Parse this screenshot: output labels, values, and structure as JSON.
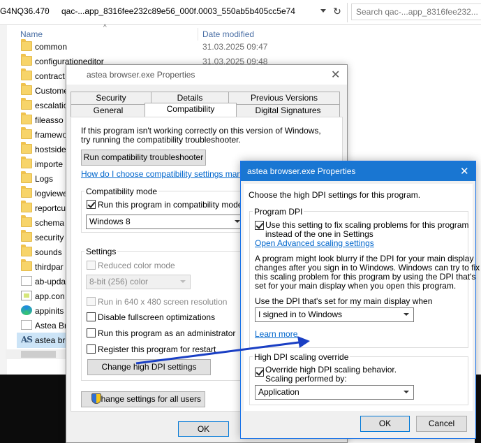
{
  "explorer": {
    "address_prefix": "G4NQ36.470",
    "address_sep": "›",
    "address_path": "qac-...app_8316fee232c89e56_000f.0003_550ab5b405cc5e74",
    "search_placeholder": "Search qac-...app_8316fee232...",
    "columns": {
      "name": "Name",
      "date": "Date modified"
    },
    "items": [
      {
        "name": "common",
        "date": "31.03.2025 09:47",
        "icon": "folder-icon"
      },
      {
        "name": "configurationeditor",
        "date": "31.03.2025 09:48",
        "icon": "folder-icon"
      },
      {
        "name": "contract",
        "date": "",
        "icon": "folder-icon"
      },
      {
        "name": "Custome",
        "date": "",
        "icon": "folder-icon"
      },
      {
        "name": "escalatio",
        "date": "",
        "icon": "folder-icon"
      },
      {
        "name": "fileasso",
        "date": "",
        "icon": "folder-icon"
      },
      {
        "name": "framewo",
        "date": "",
        "icon": "folder-icon"
      },
      {
        "name": "hostside",
        "date": "",
        "icon": "folder-icon"
      },
      {
        "name": "importe",
        "date": "",
        "icon": "folder-icon"
      },
      {
        "name": "Logs",
        "date": "",
        "icon": "folder-icon"
      },
      {
        "name": "logviewe",
        "date": "",
        "icon": "folder-icon"
      },
      {
        "name": "reportcu",
        "date": "",
        "icon": "folder-icon"
      },
      {
        "name": "schema",
        "date": "",
        "icon": "folder-icon"
      },
      {
        "name": "security",
        "date": "",
        "icon": "folder-icon"
      },
      {
        "name": "sounds",
        "date": "",
        "icon": "folder-icon"
      },
      {
        "name": "thirdpar",
        "date": "",
        "icon": "folder-icon"
      },
      {
        "name": "ab-upda",
        "date": "",
        "icon": "document-icon"
      },
      {
        "name": "app.con",
        "date": "",
        "icon": "config-file-icon"
      },
      {
        "name": "appinits",
        "date": "",
        "icon": "edge-icon"
      },
      {
        "name": "Astea Br",
        "date": "",
        "icon": "document-icon"
      },
      {
        "name": "astea bro",
        "date": "",
        "icon": "astea-app-icon"
      }
    ]
  },
  "props_dialog": {
    "title": "astea browser.exe Properties",
    "close": "✕",
    "tabs_row1": [
      "Security",
      "Details",
      "Previous Versions"
    ],
    "tabs_row2": [
      "General",
      "Compatibility",
      "Digital Signatures"
    ],
    "intro_line1": "If this program isn't working correctly on this version of Windows,",
    "intro_line2": "try running the compatibility troubleshooter.",
    "troubleshooter_button": "Run compatibility troubleshooter",
    "help_link": "How do I choose compatibility settings manually?",
    "compat_mode_label": "Compatibility mode",
    "compat_checkbox": "Run this program in compatibility mode for:",
    "compat_select": "Windows 8",
    "settings_label": "Settings",
    "reduced_color": "Reduced color mode",
    "color_select": "8-bit (256) color",
    "res_640": "Run in 640 x 480 screen resolution",
    "disable_fullscreen": "Disable fullscreen optimizations",
    "run_as_admin": "Run this program as an administrator",
    "register_restart": "Register this program for restart",
    "dpi_button": "Change high DPI settings",
    "all_users_button": "Change settings for all users",
    "ok": "OK"
  },
  "dpi_dialog": {
    "title": "astea browser.exe Properties",
    "close": "✕",
    "choose_text": "Choose the high DPI settings for this program.",
    "program_dpi_label": "Program DPI",
    "use_setting_line1": "Use this setting to fix scaling problems for this program",
    "use_setting_line2": "instead of the one in Settings",
    "advanced_link": "Open Advanced scaling settings",
    "blurry_lines": [
      "A program might look blurry if the DPI for your main display",
      "changes after you sign in to Windows. Windows can try to fix",
      "this scaling problem for this program by using the DPI that's",
      "set for your main display when you open this program."
    ],
    "use_dpi_label": "Use the DPI that's set for my main display when",
    "signin_select": "I signed in to Windows",
    "learn_more": "Learn more",
    "override_label": "High DPI scaling override",
    "override_line1": "Override high DPI scaling behavior.",
    "override_line2": "Scaling performed by:",
    "scaling_select": "Application",
    "ok": "OK",
    "cancel": "Cancel"
  },
  "annotation": {
    "arrow_color": "#1a3fc4"
  }
}
